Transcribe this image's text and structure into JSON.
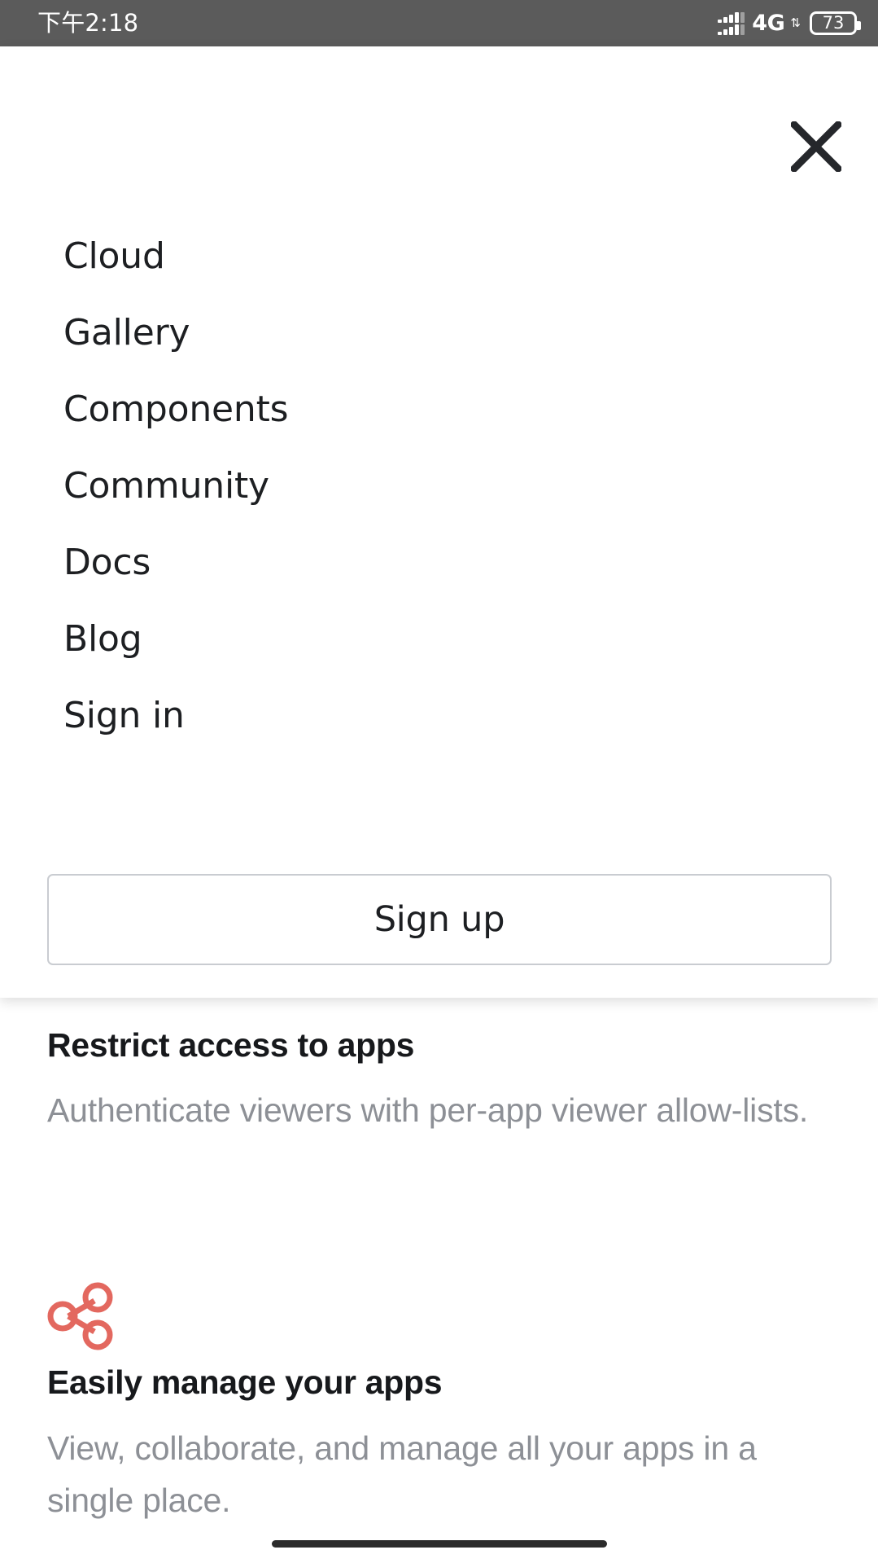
{
  "status_bar": {
    "clock": "下午2:18",
    "network_type": "4G",
    "data_arrows": "⇅",
    "battery_level": "73",
    "signal_icon": "signal-bars-icon",
    "background_color": "#5b5b5b"
  },
  "menu_overlay": {
    "close_icon": "close-icon",
    "items": [
      {
        "label": "Cloud"
      },
      {
        "label": "Gallery"
      },
      {
        "label": "Components"
      },
      {
        "label": "Community"
      },
      {
        "label": "Docs"
      },
      {
        "label": "Blog"
      },
      {
        "label": "Sign in"
      }
    ],
    "signup_label": "Sign up"
  },
  "page_content": {
    "features": [
      {
        "title": "Restrict access to apps",
        "description": "Authenticate viewers with per-app viewer allow-lists."
      },
      {
        "icon": "share-icon",
        "icon_color": "#e3685f",
        "title": "Easily manage your apps",
        "description": "View, collaborate, and manage all your apps in a single place."
      }
    ]
  },
  "colors": {
    "accent": "#e3685f",
    "text_primary": "#17191c",
    "text_muted": "#8d9096",
    "border": "#c9ccd1"
  }
}
